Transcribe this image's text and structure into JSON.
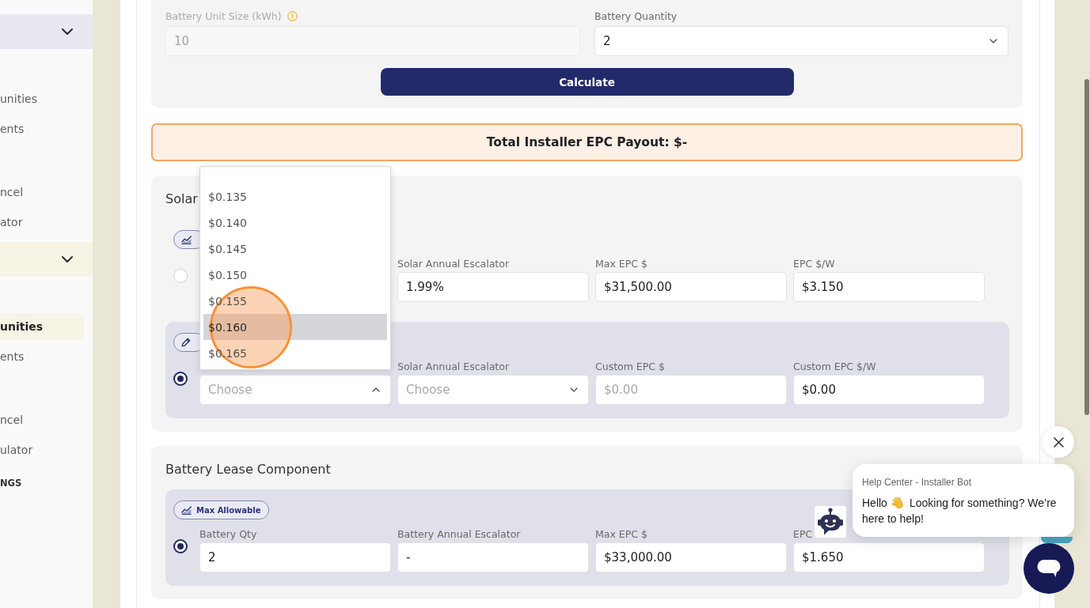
{
  "sidebar": {
    "groups": [
      {
        "color": "#e8e8f2",
        "expanded": true,
        "items": [
          {
            "label": "unities",
            "selected": false
          },
          {
            "label": "ents",
            "selected": false
          },
          {
            "label": "ncel",
            "selected": false
          },
          {
            "label": "ator",
            "selected": false
          }
        ]
      },
      {
        "color": "#f6f4e4",
        "expanded": true,
        "items": [
          {
            "label": "unities",
            "selected": true
          },
          {
            "label": "ents",
            "selected": false
          },
          {
            "label": "ncel",
            "selected": false
          },
          {
            "label": "ulator",
            "selected": false
          }
        ]
      }
    ],
    "footer_label": "NGS"
  },
  "calculator": {
    "fields": [
      {
        "kind": "input",
        "label": "Battery Unit Size (kWh)",
        "info": true,
        "disabled": true,
        "value": "10"
      },
      {
        "kind": "select",
        "label": "Battery Quantity",
        "value": "2",
        "expanded": false
      }
    ],
    "button": "Calculate"
  },
  "payout": "Total Installer EPC Payout: $-",
  "sections": [
    {
      "title": "Solar",
      "options": [
        {
          "selected": false,
          "tag": {
            "kind": "max"
          },
          "fields": [
            {
              "kind": "input",
              "label": "Solar Annual Escalator",
              "value": "1.99%"
            },
            {
              "kind": "input",
              "label": "Max EPC $",
              "value": "$31,500.00"
            },
            {
              "kind": "input",
              "label": "EPC $/W",
              "value": "$3.150"
            }
          ]
        },
        {
          "selected": true,
          "tag": {
            "kind": "custom"
          },
          "fields": [
            {
              "kind": "select",
              "placeholder": "Choose",
              "expanded": true,
              "options": [
                {
                  "label": "$0.135",
                  "selected": false
                },
                {
                  "label": "$0.140",
                  "selected": false
                },
                {
                  "label": "$0.145",
                  "selected": false
                },
                {
                  "label": "$0.150",
                  "selected": false
                },
                {
                  "label": "$0.155",
                  "selected": false
                },
                {
                  "label": "$0.160",
                  "selected": true
                },
                {
                  "label": "$0.165",
                  "selected": false
                }
              ]
            },
            {
              "kind": "select",
              "label": "Solar Annual Escalator",
              "placeholder": "Choose",
              "expanded": false
            },
            {
              "kind": "input",
              "label": "Custom EPC $",
              "placeholder": "$0.00"
            },
            {
              "kind": "input",
              "label": "Custom EPC $/W",
              "value": "$0.00"
            }
          ]
        }
      ]
    },
    {
      "title": "Battery Lease Component",
      "options": [
        {
          "selected": true,
          "tag": {
            "kind": "max",
            "label": "Max Allowable"
          },
          "fields": [
            {
              "kind": "input",
              "label": "Battery Qty",
              "value": "2"
            },
            {
              "kind": "input",
              "label": "Battery Annual Escalator",
              "value": "-"
            },
            {
              "kind": "input",
              "label": "Max EPC $",
              "value": "$33,000.00"
            },
            {
              "kind": "input",
              "label": "EPC",
              "value": "$1.650"
            }
          ]
        }
      ]
    }
  ],
  "chat": {
    "title": "Help Center - Installer Bot",
    "greeting": "Hello",
    "message_lines": [
      "Looking for something? We’re",
      "here to help!"
    ]
  }
}
